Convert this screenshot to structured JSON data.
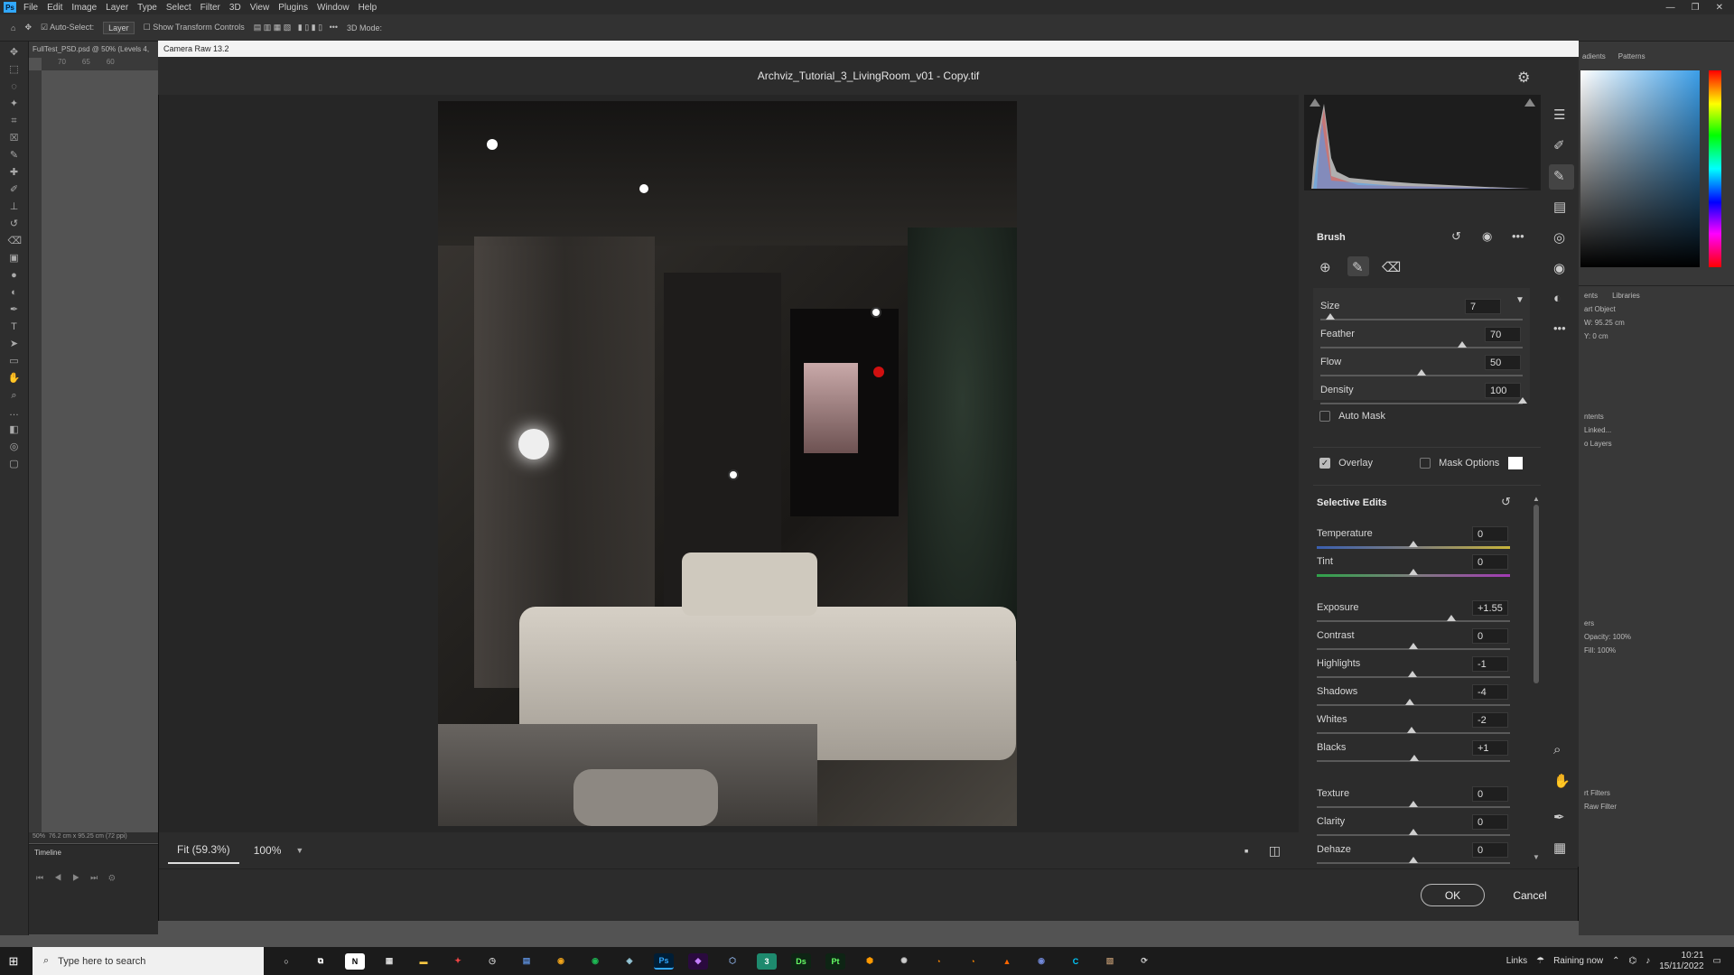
{
  "ps": {
    "menu": [
      "File",
      "Edit",
      "Image",
      "Layer",
      "Type",
      "Select",
      "Filter",
      "3D",
      "View",
      "Plugins",
      "Window",
      "Help"
    ],
    "options": {
      "auto_select": "Auto-Select:",
      "layer": "Layer",
      "transform": "Show Transform Controls",
      "mode": "3D Mode:"
    },
    "doc_tab": "FullTest_PSD.psd @ 50% (Levels 4,",
    "ruler": [
      "70",
      "65",
      "60"
    ],
    "status_zoom": "50%",
    "status_dims": "76.2 cm x 95.25 cm (72 ppi)",
    "timeline": "Timeline",
    "right_tabs": [
      "adients",
      "Patterns"
    ],
    "props_tabs": [
      "ents",
      "Libraries"
    ],
    "props": {
      "type": "art Object",
      "w": "W: 95.25 cm",
      "y": "Y: 0 cm",
      "b1": "ntents",
      "b2": "Linked...",
      "b3": "o Layers"
    },
    "layers": {
      "tab": "ers",
      "opacity": "Opacity: 100%",
      "fill": "Fill: 100%",
      "smart_filters": "rt Filters",
      "raw_filter": "Raw Filter"
    }
  },
  "camera_raw": {
    "window_title": "Camera Raw 13.2",
    "file_name": "Archviz_Tutorial_3_LivingRoom_v01 - Copy.tif",
    "zoom_fit": "Fit (59.3%)",
    "zoom_pct": "100%",
    "ok": "OK",
    "cancel": "Cancel",
    "brush": {
      "title": "Brush",
      "size": {
        "label": "Size",
        "value": "7",
        "pos": 0.05
      },
      "feather": {
        "label": "Feather",
        "value": "70",
        "pos": 0.7
      },
      "flow": {
        "label": "Flow",
        "value": "50",
        "pos": 0.5
      },
      "density": {
        "label": "Density",
        "value": "100",
        "pos": 1.0
      },
      "auto_mask": "Auto Mask",
      "overlay": "Overlay",
      "mask_options": "Mask Options"
    },
    "selective": {
      "title": "Selective Edits",
      "sliders": [
        {
          "label": "Temperature",
          "value": "0",
          "pos": 0.5,
          "grad": "linear-gradient(to right,#3a5fb0,#7d7d7d,#c8b43a)"
        },
        {
          "label": "Tint",
          "value": "0",
          "pos": 0.5,
          "grad": "linear-gradient(to right,#2fa34a,#7d7d7d,#a23ab4)"
        },
        {
          "label": "Exposure",
          "value": "+1.55",
          "pos": 0.695,
          "grad": ""
        },
        {
          "label": "Contrast",
          "value": "0",
          "pos": 0.5,
          "grad": ""
        },
        {
          "label": "Highlights",
          "value": "-1",
          "pos": 0.495,
          "grad": ""
        },
        {
          "label": "Shadows",
          "value": "-4",
          "pos": 0.48,
          "grad": ""
        },
        {
          "label": "Whites",
          "value": "-2",
          "pos": 0.49,
          "grad": ""
        },
        {
          "label": "Blacks",
          "value": "+1",
          "pos": 0.505,
          "grad": ""
        },
        {
          "label": "Texture",
          "value": "0",
          "pos": 0.5,
          "grad": ""
        },
        {
          "label": "Clarity",
          "value": "0",
          "pos": 0.5,
          "grad": ""
        },
        {
          "label": "Dehaze",
          "value": "0",
          "pos": 0.5,
          "grad": ""
        }
      ]
    }
  },
  "taskbar": {
    "search": "Type here to search",
    "links": "Links",
    "weather": "Raining now",
    "time": "10:21",
    "date": "15/11/2022"
  },
  "colors": {
    "ps_blue": "#31a8ff",
    "spotify": "#1db954",
    "premiere": "#9999ff",
    "after": "#9a7dff"
  }
}
